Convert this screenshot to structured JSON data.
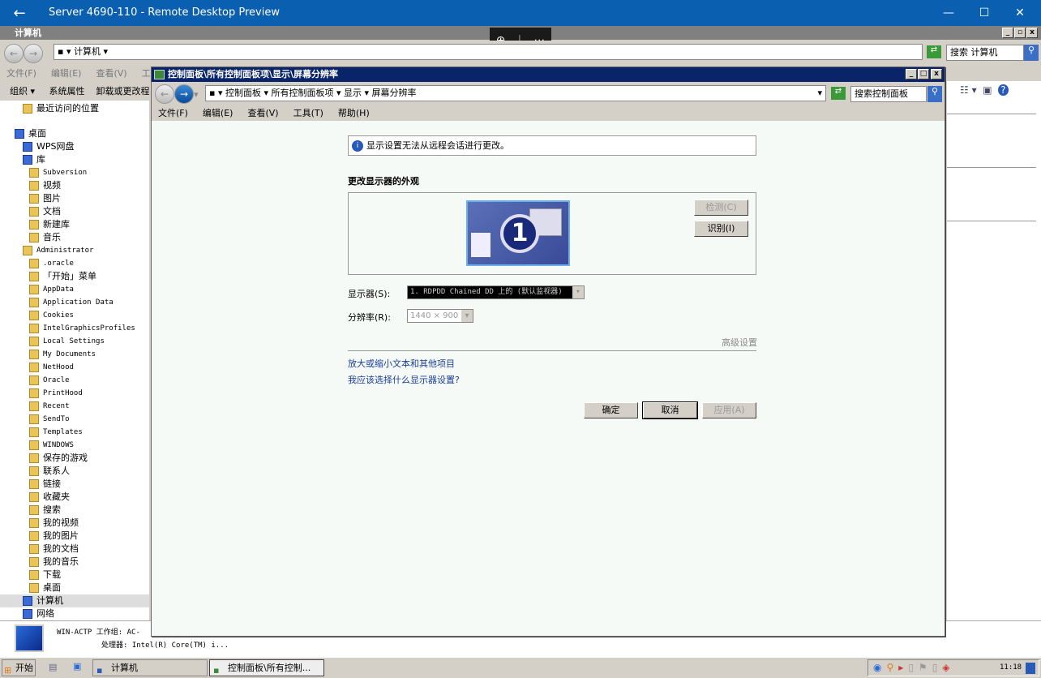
{
  "rd": {
    "title": "Server 4690-110 - Remote Desktop Preview"
  },
  "explorer": {
    "title": "计算机",
    "address": "计算机",
    "search_placeholder": "搜索 计算机",
    "menu": [
      "文件(F)",
      "编辑(E)",
      "查看(V)",
      "工具"
    ],
    "toolbar": [
      "组织",
      "系统属性",
      "卸载或更改程"
    ],
    "sidebar": [
      {
        "label": "最近访问的位置",
        "level": 1
      },
      {
        "label": "桌面",
        "level": 0
      },
      {
        "label": "WPS网盘",
        "level": 1
      },
      {
        "label": "库",
        "level": 1
      },
      {
        "label": "Subversion",
        "level": 2
      },
      {
        "label": "视频",
        "level": 2
      },
      {
        "label": "图片",
        "level": 2
      },
      {
        "label": "文档",
        "level": 2
      },
      {
        "label": "新建库",
        "level": 2
      },
      {
        "label": "音乐",
        "level": 2
      },
      {
        "label": "Administrator",
        "level": 1
      },
      {
        "label": ".oracle",
        "level": 2
      },
      {
        "label": "「开始」菜单",
        "level": 2
      },
      {
        "label": "AppData",
        "level": 2
      },
      {
        "label": "Application Data",
        "level": 2
      },
      {
        "label": "Cookies",
        "level": 2
      },
      {
        "label": "IntelGraphicsProfiles",
        "level": 2
      },
      {
        "label": "Local Settings",
        "level": 2
      },
      {
        "label": "My Documents",
        "level": 2
      },
      {
        "label": "NetHood",
        "level": 2
      },
      {
        "label": "Oracle",
        "level": 2
      },
      {
        "label": "PrintHood",
        "level": 2
      },
      {
        "label": "Recent",
        "level": 2
      },
      {
        "label": "SendTo",
        "level": 2
      },
      {
        "label": "Templates",
        "level": 2
      },
      {
        "label": "WINDOWS",
        "level": 2
      },
      {
        "label": "保存的游戏",
        "level": 2
      },
      {
        "label": "联系人",
        "level": 2
      },
      {
        "label": "链接",
        "level": 2
      },
      {
        "label": "收藏夹",
        "level": 2
      },
      {
        "label": "搜索",
        "level": 2
      },
      {
        "label": "我的视频",
        "level": 2
      },
      {
        "label": "我的图片",
        "level": 2
      },
      {
        "label": "我的文档",
        "level": 2
      },
      {
        "label": "我的音乐",
        "level": 2
      },
      {
        "label": "下载",
        "level": 2
      },
      {
        "label": "桌面",
        "level": 2
      },
      {
        "label": "计算机",
        "level": 1,
        "selected": true
      },
      {
        "label": "网络",
        "level": 1
      }
    ],
    "details": {
      "line1": "WIN-ACTP 工作组: AC-",
      "line2": "处理器: Intel(R) Core(TM) i..."
    }
  },
  "cp": {
    "title": "控制面板\\所有控制面板项\\显示\\屏幕分辨率",
    "breadcrumb": [
      "控制面板",
      "所有控制面板项",
      "显示",
      "屏幕分辨率"
    ],
    "search_placeholder": "搜索控制面板",
    "menu": [
      "文件(F)",
      "编辑(E)",
      "查看(V)",
      "工具(T)",
      "帮助(H)"
    ],
    "info": "显示设置无法从远程会话进行更改。",
    "heading": "更改显示器的外观",
    "monitor_number": "1",
    "detect": "检测(C)",
    "identify": "识别(I)",
    "display_label": "显示器(S):",
    "display_value": "1. RDPDD Chained DD 上的 (默认监视器)",
    "resolution_label": "分辨率(R):",
    "resolution_value": "1440 × 900",
    "advanced": "高级设置",
    "link1": "放大或缩小文本和其他项目",
    "link2": "我应该选择什么显示器设置?",
    "ok": "确定",
    "cancel": "取消",
    "apply": "应用(A)"
  },
  "taskbar": {
    "start": "开始",
    "items": [
      "计算机",
      "控制面板\\所有控制..."
    ],
    "clock": "11:18"
  }
}
